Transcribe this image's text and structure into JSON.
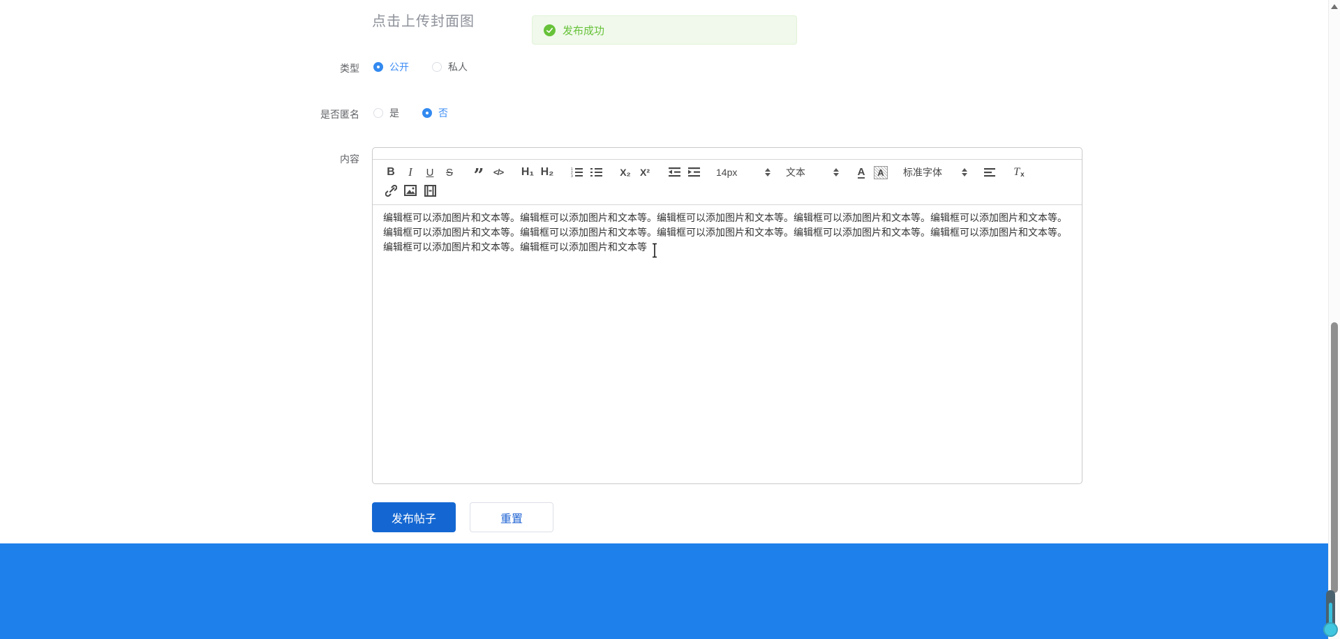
{
  "upload": {
    "placeholder": "点击上传封面图"
  },
  "toast": {
    "message": "发布成功"
  },
  "form": {
    "type": {
      "label": "类型",
      "options": [
        {
          "text": "公开",
          "selected": true
        },
        {
          "text": "私人",
          "selected": false
        }
      ]
    },
    "anonymous": {
      "label": "是否匿名",
      "options": [
        {
          "text": "是",
          "selected": false
        },
        {
          "text": "否",
          "selected": true
        }
      ]
    },
    "content": {
      "label": "内容"
    }
  },
  "editor": {
    "toolbar": {
      "bold": "B",
      "italic": "I",
      "underline": "U",
      "strikethrough": "S",
      "blockquote": "”",
      "code_block": "</>",
      "heading1": "H₁",
      "heading2": "H₂",
      "subscript": "X₂",
      "superscript": "X²",
      "font_size_value": "14px",
      "paragraph_format_value": "文本",
      "font_color": "A",
      "bg_color": "A",
      "font_family_value": "标准字体",
      "clear_format": "T",
      "clear_format_sub": "x"
    },
    "content_text": "编辑框可以添加图片和文本等。编辑框可以添加图片和文本等。编辑框可以添加图片和文本等。编辑框可以添加图片和文本等。编辑框可以添加图片和文本等。编辑框可以添加图片和文本等。编辑框可以添加图片和文本等。编辑框可以添加图片和文本等。编辑框可以添加图片和文本等。编辑框可以添加图片和文本等。编辑框可以添加图片和文本等。编辑框可以添加图片和文本等"
  },
  "actions": {
    "submit": "发布帖子",
    "reset": "重置"
  },
  "colors": {
    "primary_radio": "#338af0",
    "submit_button": "#1467d2",
    "reset_text": "#2265d4",
    "footer": "#1e80ea",
    "success": "#67c23a",
    "success_bg": "#f0f9eb"
  }
}
